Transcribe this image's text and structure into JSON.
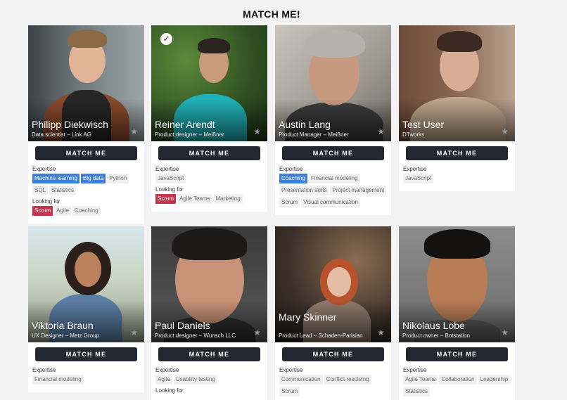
{
  "page_title": "MATCH ME!",
  "labels": {
    "match_button": "MATCH ME",
    "expertise": "Expertise",
    "looking_for": "Looking for"
  },
  "icons": {
    "favorite": "star-icon",
    "selected": "check-icon"
  },
  "colors": {
    "highlight_expertise": "#3f7fd8",
    "highlight_looking_for": "#c8334c",
    "button": "#23272f"
  },
  "cards": [
    {
      "name": "Philipp Diekwisch",
      "subtitle": "Data scientist – Link AG",
      "selected": false,
      "expertise_highlight": [
        "Machine learning",
        "Big data"
      ],
      "expertise": [
        "Python",
        "SQL",
        "Statistics"
      ],
      "looking_for_highlight": [
        "Scrum"
      ],
      "looking_for": [
        "Agile",
        "Coaching"
      ]
    },
    {
      "name": "Reiner Arendt",
      "subtitle": "Product designer – Meißner",
      "selected": true,
      "expertise_highlight": [],
      "expertise": [
        "JavaScript"
      ],
      "looking_for_highlight": [
        "Scrum"
      ],
      "looking_for": [
        "Agile Teams",
        "Marketing"
      ]
    },
    {
      "name": "Austin Lang",
      "subtitle": "Product Manager – Meißner",
      "selected": false,
      "expertise_highlight": [
        "Coaching"
      ],
      "expertise": [
        "Financial modeling",
        "Presentation skills",
        "Project management",
        "Scrum",
        "Visual communication"
      ],
      "looking_for_highlight": [],
      "looking_for": []
    },
    {
      "name": "Test User",
      "subtitle": "DTworks",
      "selected": false,
      "expertise_highlight": [],
      "expertise": [
        "JavaScript"
      ],
      "looking_for_highlight": [],
      "looking_for": []
    },
    {
      "name": "Viktoria Braun",
      "subtitle": "UX Designer – Metz Group",
      "selected": false,
      "expertise_highlight": [],
      "expertise": [
        "Financial modeling"
      ],
      "looking_for_highlight": [],
      "looking_for": []
    },
    {
      "name": "Paul Daniels",
      "subtitle": "Product designer – Wunsch LLC",
      "selected": false,
      "expertise_highlight": [],
      "expertise": [
        "Agile",
        "Usability testing"
      ],
      "looking_for_highlight": [],
      "looking_for": []
    },
    {
      "name": "Mary Skinner",
      "subtitle": "Product Lead – Schaden-Parisian",
      "selected": false,
      "expertise_highlight": [],
      "expertise": [
        "Communication",
        "Conflict resolving",
        "Scrum"
      ],
      "looking_for_highlight": [],
      "looking_for": []
    },
    {
      "name": "Nikolaus Lobe",
      "subtitle": "Product owner – Botstation",
      "selected": false,
      "expertise_highlight": [],
      "expertise": [
        "Agile Teams",
        "Collaboration",
        "Leadership",
        "Statistics"
      ],
      "looking_for_highlight": [],
      "looking_for": []
    }
  ]
}
